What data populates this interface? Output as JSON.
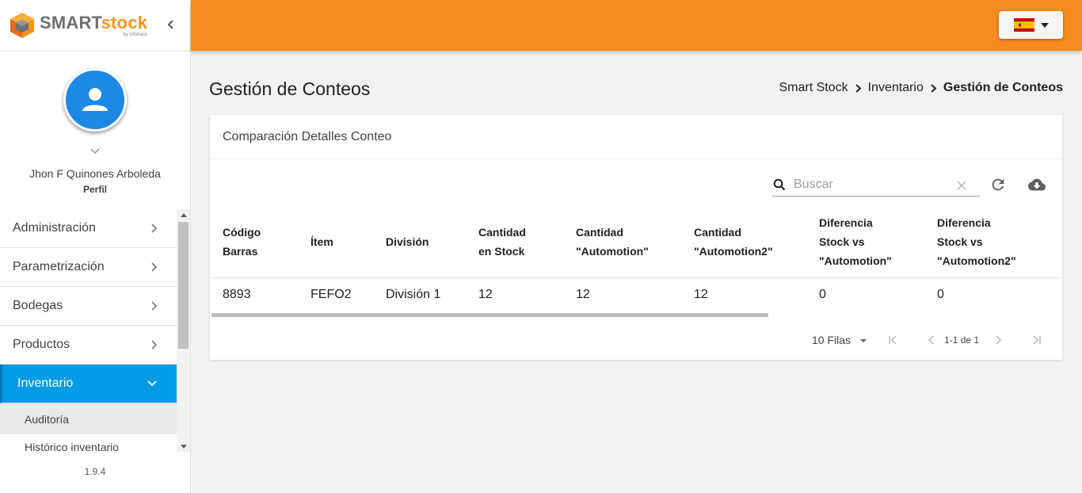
{
  "brand": {
    "name_a": "SMART",
    "name_b": "stock",
    "sub": "by infotrack"
  },
  "profile": {
    "name": "Jhon F Quinones Arboleda",
    "role": "Perfil"
  },
  "menu": {
    "items": [
      {
        "label": "Administración"
      },
      {
        "label": "Parametrización"
      },
      {
        "label": "Bodegas"
      },
      {
        "label": "Productos"
      },
      {
        "label": "Inventario"
      }
    ],
    "submenu": [
      {
        "label": "Auditoría"
      },
      {
        "label": "Histórico inventario"
      }
    ]
  },
  "version": "1.9.4",
  "language": {
    "selected": "es",
    "flag_colors": [
      "#c60b1e",
      "#ffc400"
    ]
  },
  "page": {
    "title": "Gestión de Conteos",
    "breadcrumb": [
      "Smart Stock",
      "Inventario",
      "Gestión de Conteos"
    ]
  },
  "card": {
    "title": "Comparación Detalles Conteo",
    "search_placeholder": "Buscar",
    "columns": [
      [
        "Código",
        "Barras"
      ],
      [
        "Ítem"
      ],
      [
        "División"
      ],
      [
        "Cantidad",
        "en Stock"
      ],
      [
        "Cantidad",
        "\"Automotion\""
      ],
      [
        "Cantidad",
        "\"Automotion2\""
      ],
      [
        "Diferencia",
        "Stock vs",
        "\"Automotion\""
      ],
      [
        "Diferencia",
        "Stock vs",
        "\"Automotion2\""
      ]
    ],
    "rows": [
      [
        "8893",
        "FEFO2",
        "División 1",
        "12",
        "12",
        "12",
        "0",
        "0"
      ]
    ],
    "pagination": {
      "rows_label": "10 Filas",
      "range": "1-1 de 1"
    }
  },
  "colors": {
    "header": "#f68b1f",
    "active_menu": "#039be5",
    "avatar": "#1e88e5"
  }
}
